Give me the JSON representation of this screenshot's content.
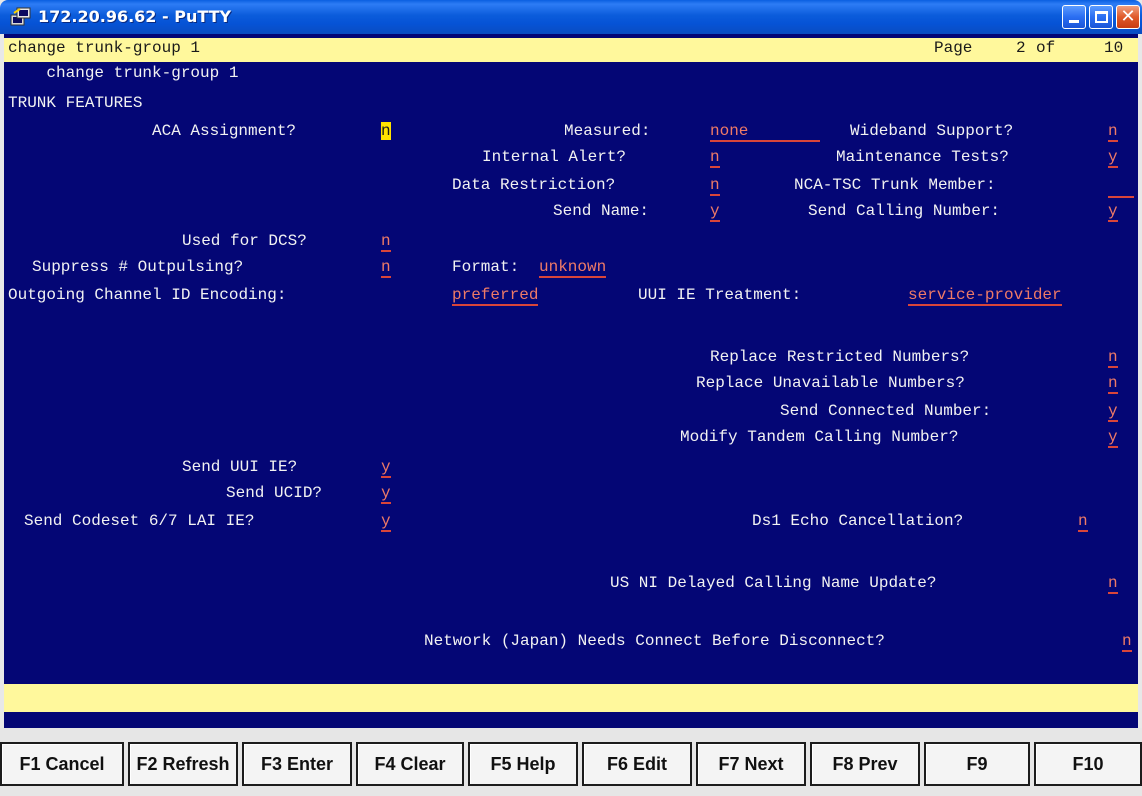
{
  "window": {
    "title": "172.20.96.62 - PuTTY"
  },
  "terminal": {
    "command": "change trunk-group 1",
    "page_label": "Page",
    "page_current": "2",
    "page_of": "of",
    "page_total": "10",
    "section_title": "TRUNK FEATURES",
    "fields": {
      "aca_assignment": {
        "label": "ACA Assignment?",
        "value": "n"
      },
      "measured": {
        "label": "Measured:",
        "value": "none"
      },
      "wideband_support": {
        "label": "Wideband Support?",
        "value": "n"
      },
      "internal_alert": {
        "label": "Internal Alert?",
        "value": "n"
      },
      "maintenance_tests": {
        "label": "Maintenance Tests?",
        "value": "y"
      },
      "data_restriction": {
        "label": "Data Restriction?",
        "value": "n"
      },
      "nca_tsc_trunk_member": {
        "label": "NCA-TSC Trunk Member:",
        "value": ""
      },
      "send_name": {
        "label": "Send Name:",
        "value": "y"
      },
      "send_calling_number": {
        "label": "Send Calling Number:",
        "value": "y"
      },
      "used_for_dcs": {
        "label": "Used for DCS?",
        "value": "n"
      },
      "suppress_outpulsing": {
        "label": "Suppress # Outpulsing?",
        "value": "n"
      },
      "format": {
        "label": "Format:",
        "value": "unknown"
      },
      "outgoing_channel_id_encoding": {
        "label": "Outgoing Channel ID Encoding:",
        "value": "preferred"
      },
      "uui_ie_treatment": {
        "label": "UUI IE Treatment:",
        "value": "service-provider"
      },
      "replace_restricted_numbers": {
        "label": "Replace Restricted Numbers?",
        "value": "n"
      },
      "replace_unavailable_numbers": {
        "label": "Replace Unavailable Numbers?",
        "value": "n"
      },
      "send_connected_number": {
        "label": "Send Connected Number:",
        "value": "y"
      },
      "modify_tandem_calling_number": {
        "label": "Modify Tandem Calling Number?",
        "value": "y"
      },
      "send_uui_ie": {
        "label": "Send UUI IE?",
        "value": "y"
      },
      "send_ucid": {
        "label": "Send UCID?",
        "value": "y"
      },
      "send_codeset_lai_ie": {
        "label": "Send Codeset 6/7 LAI IE?",
        "value": "y"
      },
      "ds1_echo_cancellation": {
        "label": "Ds1 Echo Cancellation?",
        "value": "n"
      },
      "us_ni_delayed_calling_name_update": {
        "label": "US NI Delayed Calling Name Update?",
        "value": "n"
      },
      "network_japan_connect_before_disconnect": {
        "label": "Network (Japan) Needs Connect Before Disconnect?",
        "value": "n"
      }
    }
  },
  "function_keys": [
    {
      "label": "F1 Cancel"
    },
    {
      "label": "F2 Refresh"
    },
    {
      "label": "F3 Enter"
    },
    {
      "label": "F4 Clear"
    },
    {
      "label": "F5 Help"
    },
    {
      "label": "F6 Edit"
    },
    {
      "label": "F7 Next"
    },
    {
      "label": "F8 Prev"
    },
    {
      "label": "F9"
    },
    {
      "label": "F10"
    }
  ],
  "colors": {
    "terminal_bg": "#040675",
    "terminal_fg": "#f2f2f2",
    "field_value": "#ee7a67",
    "highlight_bar": "#fff89c",
    "cursor": "#ffe100"
  },
  "icons": {
    "app_icon": "putty-icon",
    "minimize": "minimize-icon",
    "maximize": "maximize-icon",
    "close": "close-icon"
  }
}
